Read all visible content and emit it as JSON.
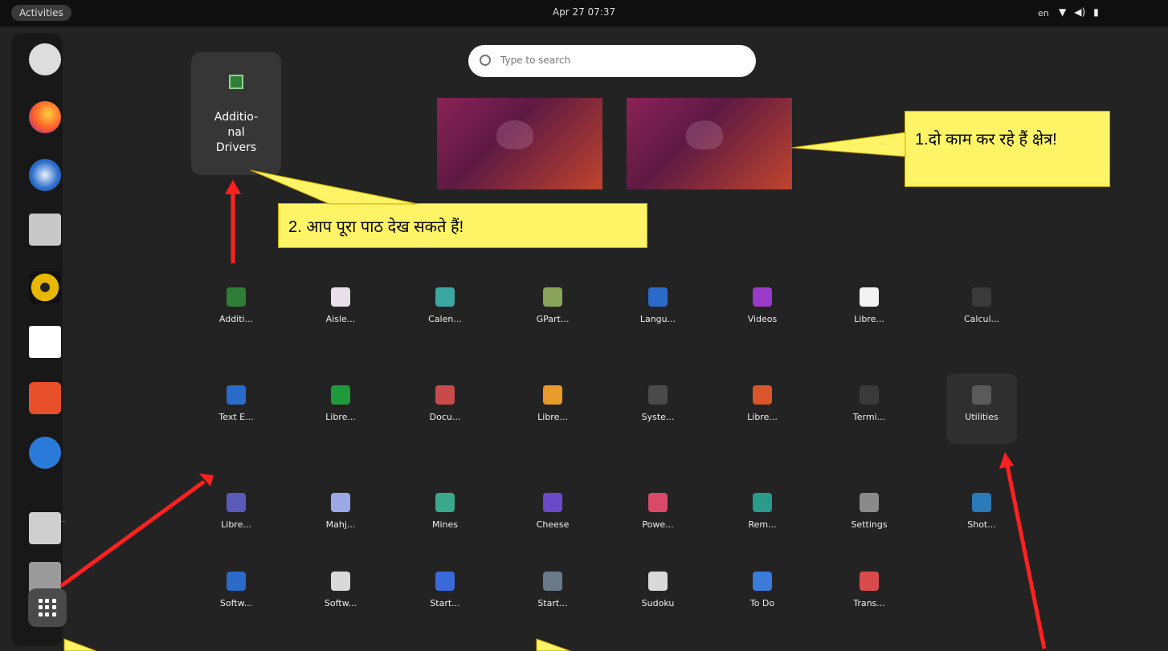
{
  "topbar": {
    "activities": "Activities",
    "clock": "Apr 27  07:37",
    "language": "en",
    "tray_icons": [
      "wifi-icon",
      "volume-icon",
      "power-icon"
    ]
  },
  "dock": {
    "items": [
      "disk-utility-icon",
      "firefox-icon",
      "thunderbird-icon",
      "files-icon",
      "rhythmbox-icon",
      "writer-icon",
      "software-icon",
      "help-icon",
      "sd-card-icon",
      "drive-icon"
    ],
    "show_apps": "show-applications-icon"
  },
  "search": {
    "placeholder": "Type to search"
  },
  "folder": {
    "label": "Additio-\nnal\nDrivers"
  },
  "callouts": {
    "workspaces": "1.दो काम कर रहे हैं क्षेत्र!",
    "fulltext": "2. आप पूरा पाठ देख सकते हैं!"
  },
  "apps": [
    [
      {
        "label": "Additi...",
        "color": "#2f7d37"
      },
      {
        "label": "Aisle...",
        "color": "#e8e0e8"
      },
      {
        "label": "Calen...",
        "color": "#3aa8a0"
      },
      {
        "label": "GPart...",
        "color": "#8aa35a"
      },
      {
        "label": "Langu...",
        "color": "#2a6ac9"
      },
      {
        "label": "Videos",
        "color": "#9a3ac9"
      },
      {
        "label": "Libre...",
        "color": "#f2f2f2"
      },
      {
        "label": "Calcul...",
        "color": "#3a3a3a"
      }
    ],
    [
      {
        "label": "Text E...",
        "color": "#2a6ac9"
      },
      {
        "label": "Libre...",
        "color": "#1f9a3a"
      },
      {
        "label": "Docu...",
        "color": "#c94a4a"
      },
      {
        "label": "Libre...",
        "color": "#e89a2a"
      },
      {
        "label": "Syste...",
        "color": "#4a4a4a"
      },
      {
        "label": "Libre...",
        "color": "#d9552a"
      },
      {
        "label": "Termi...",
        "color": "#3a3a3a"
      },
      {
        "label": "Utilities",
        "color": "#5a5a5a"
      }
    ],
    [
      {
        "label": "Libre...",
        "color": "#5a5ab9"
      },
      {
        "label": "Mahj...",
        "color": "#9aa8e8"
      },
      {
        "label": "Mines",
        "color": "#3aa88a"
      },
      {
        "label": "Cheese",
        "color": "#6a4ac9"
      },
      {
        "label": "Powe...",
        "color": "#d94a6a"
      },
      {
        "label": "Rem...",
        "color": "#2a9a8a"
      },
      {
        "label": "Settings",
        "color": "#8a8a8a"
      },
      {
        "label": "Shot...",
        "color": "#2a7ab9"
      }
    ],
    [
      {
        "label": "Softw...",
        "color": "#2a6ac9"
      },
      {
        "label": "Softw...",
        "color": "#d9d9d9"
      },
      {
        "label": "Start...",
        "color": "#3a6ad9"
      },
      {
        "label": "Start...",
        "color": "#6a7a8a"
      },
      {
        "label": "Sudoku",
        "color": "#d9d9d9"
      },
      {
        "label": "To Do",
        "color": "#3a7ad9"
      },
      {
        "label": "Trans...",
        "color": "#d94a4a"
      }
    ]
  ]
}
